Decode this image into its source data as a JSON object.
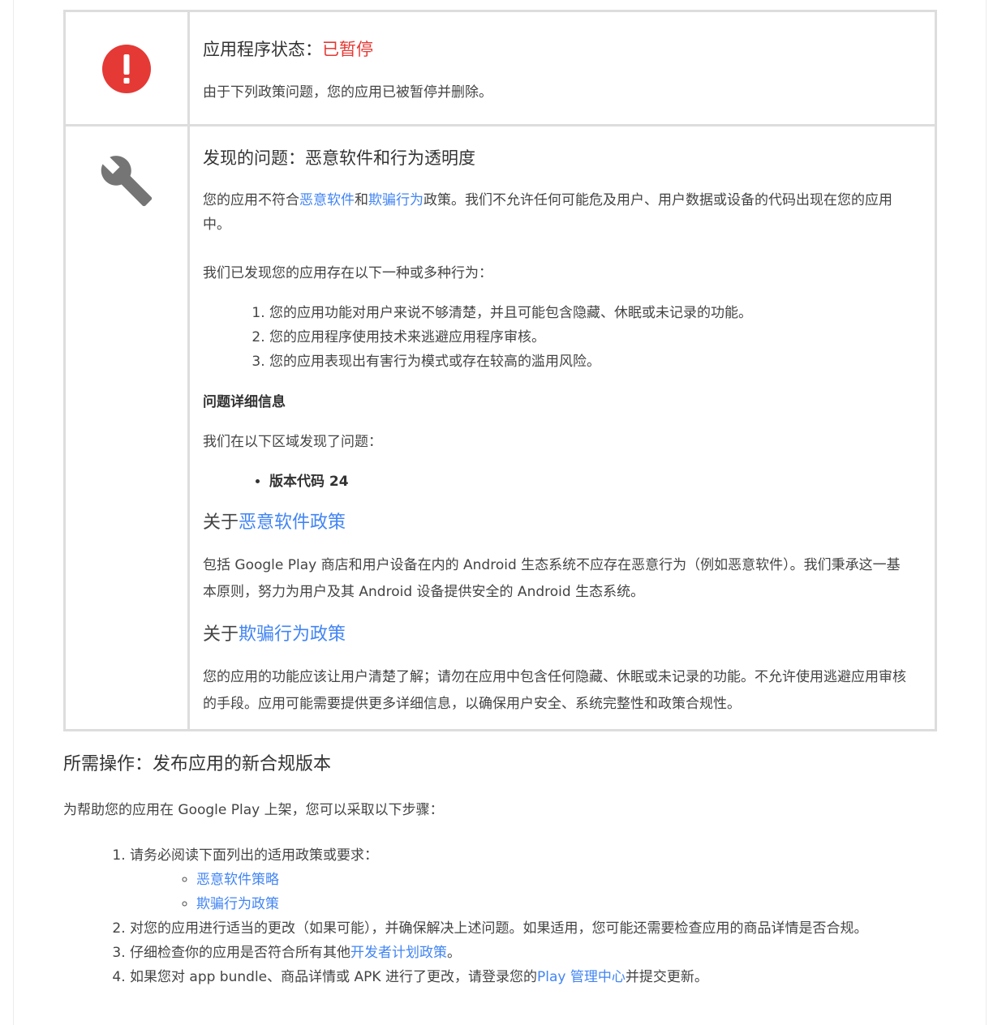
{
  "status": {
    "title_label": "应用程序状态：",
    "title_value": "已暂停",
    "description": "由于下列政策问题，您的应用已被暂停并删除。"
  },
  "issue": {
    "title": "发现的问题：恶意软件和行为透明度",
    "desc_part1": "您的应用不符合",
    "desc_link1": "恶意软件",
    "desc_part2": "和",
    "desc_link2": "欺骗行为",
    "desc_part3": "政策。我们不允许任何可能危及用户、用户数据或设备的代码出现在您的应用中。",
    "behaviors_intro": "我们已发现您的应用存在以下一种或多种行为：",
    "behaviors": [
      "您的应用功能对用户来说不够清楚，并且可能包含隐藏、休眠或未记录的功能。",
      "您的应用程序使用技术来逃避应用程序审核。",
      "您的应用表现出有害行为模式或存在较高的滥用风险。"
    ],
    "details_heading": "问题详细信息",
    "details_intro": "我们在以下区域发现了问题：",
    "details_items": [
      "版本代码 24"
    ],
    "about1_prefix": "关于",
    "about1_link": "恶意软件政策",
    "about1_body": "包括 Google Play 商店和用户设备在内的 Android 生态系统不应存在恶意行为（例如恶意软件）。我们秉承这一基本原则，努力为用户及其 Android 设备提供安全的 Android 生态系统。",
    "about2_prefix": "关于",
    "about2_link": "欺骗行为政策",
    "about2_body": "您的应用的功能应该让用户清楚了解；请勿在应用中包含任何隐藏、休眠或未记录的功能。不允许使用逃避应用审核的手段。应用可能需要提供更多详细信息，以确保用户安全、系统完整性和政策合规性。"
  },
  "action": {
    "heading": "所需操作：发布应用的新合规版本",
    "intro": "为帮助您的应用在 Google Play 上架，您可以采取以下步骤：",
    "step1": "请务必阅读下面列出的适用政策或要求：",
    "step1_links": [
      "恶意软件策略",
      "欺骗行为政策"
    ],
    "step2": "对您的应用进行适当的更改（如果可能），并确保解决上述问题。如果适用，您可能还需要检查应用的商品详情是否合规。",
    "step3_prefix": "仔细检查你的应用是否符合所有其他",
    "step3_link": "开发者计划政策",
    "step3_suffix": "。",
    "step4_prefix": "如果您对 app bundle、商品详情或 APK 进行了更改，请登录您的",
    "step4_link": "Play 管理中心",
    "step4_suffix": "并提交更新。"
  },
  "icons": {
    "status_icon": "error-alert-icon",
    "issue_icon": "wrench-icon"
  },
  "colors": {
    "alert_red": "#e53935",
    "link_blue": "#4285f4",
    "border_gray": "#dddddd",
    "icon_gray": "#757575"
  }
}
